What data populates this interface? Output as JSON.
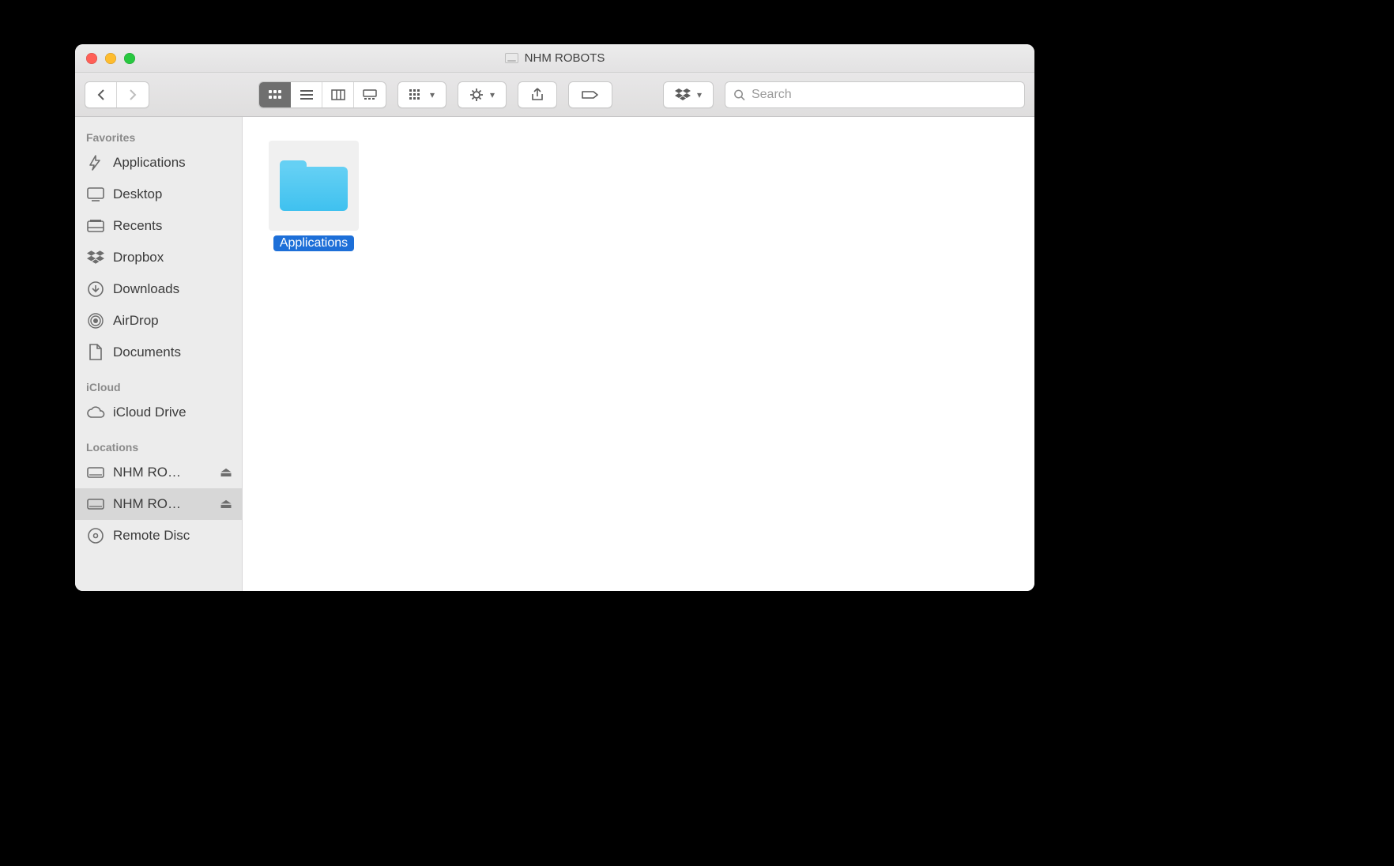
{
  "window": {
    "title": "NHM ROBOTS"
  },
  "search": {
    "placeholder": "Search"
  },
  "sidebar": {
    "sections": [
      {
        "header": "Favorites",
        "items": [
          {
            "label": "Applications",
            "icon": "applications-icon"
          },
          {
            "label": "Desktop",
            "icon": "desktop-icon"
          },
          {
            "label": "Recents",
            "icon": "recents-icon"
          },
          {
            "label": "Dropbox",
            "icon": "dropbox-icon"
          },
          {
            "label": "Downloads",
            "icon": "downloads-icon"
          },
          {
            "label": "AirDrop",
            "icon": "airdrop-icon"
          },
          {
            "label": "Documents",
            "icon": "documents-icon"
          }
        ]
      },
      {
        "header": "iCloud",
        "items": [
          {
            "label": "iCloud Drive",
            "icon": "cloud-icon"
          }
        ]
      },
      {
        "header": "Locations",
        "items": [
          {
            "label": "NHM RO…",
            "icon": "disk-icon",
            "ejectable": true
          },
          {
            "label": "NHM RO…",
            "icon": "disk-icon",
            "ejectable": true,
            "selected": true
          },
          {
            "label": "Remote Disc",
            "icon": "optical-disc-icon"
          }
        ]
      }
    ]
  },
  "content": {
    "items": [
      {
        "label": "Applications",
        "type": "folder",
        "selected": true
      }
    ]
  }
}
